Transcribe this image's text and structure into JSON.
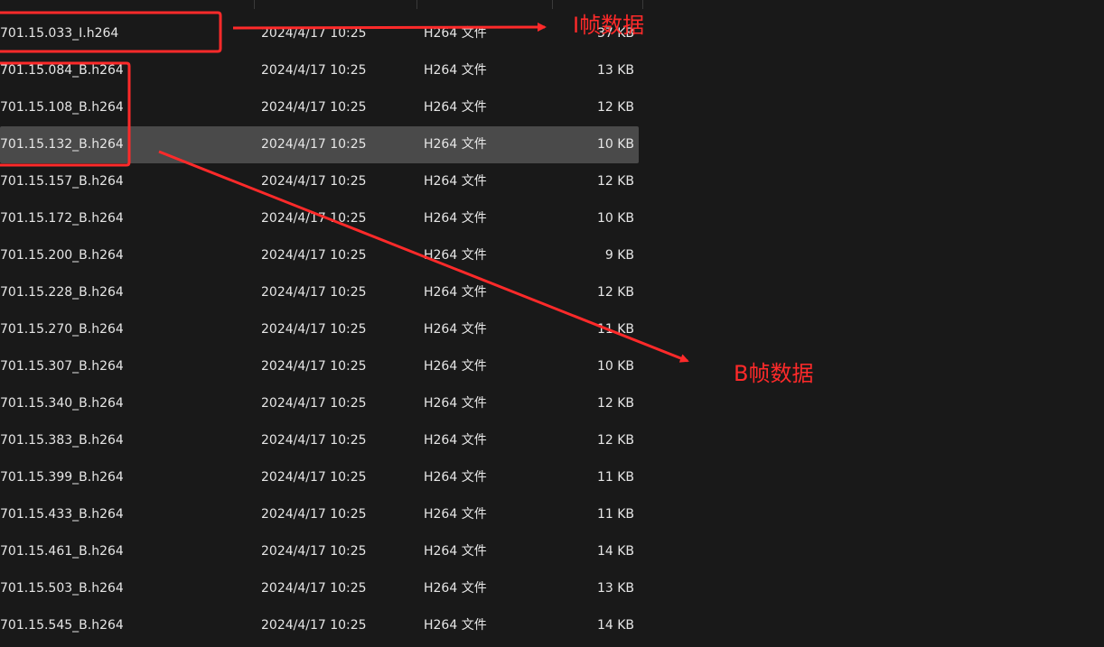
{
  "annotations": {
    "i_frame_label": "I帧数据",
    "b_frame_label": "B帧数据",
    "color": "#ff2a2a"
  },
  "files": [
    {
      "name": "701.15.033_I.h264",
      "date": "2024/4/17 10:25",
      "type": "H264 文件",
      "size": "37 KB"
    },
    {
      "name": "701.15.084_B.h264",
      "date": "2024/4/17 10:25",
      "type": "H264 文件",
      "size": "13 KB"
    },
    {
      "name": "701.15.108_B.h264",
      "date": "2024/4/17 10:25",
      "type": "H264 文件",
      "size": "12 KB"
    },
    {
      "name": "701.15.132_B.h264",
      "date": "2024/4/17 10:25",
      "type": "H264 文件",
      "size": "10 KB",
      "selected": true
    },
    {
      "name": "701.15.157_B.h264",
      "date": "2024/4/17 10:25",
      "type": "H264 文件",
      "size": "12 KB"
    },
    {
      "name": "701.15.172_B.h264",
      "date": "2024/4/17 10:25",
      "type": "H264 文件",
      "size": "10 KB"
    },
    {
      "name": "701.15.200_B.h264",
      "date": "2024/4/17 10:25",
      "type": "H264 文件",
      "size": "9 KB"
    },
    {
      "name": "701.15.228_B.h264",
      "date": "2024/4/17 10:25",
      "type": "H264 文件",
      "size": "12 KB"
    },
    {
      "name": "701.15.270_B.h264",
      "date": "2024/4/17 10:25",
      "type": "H264 文件",
      "size": "11 KB"
    },
    {
      "name": "701.15.307_B.h264",
      "date": "2024/4/17 10:25",
      "type": "H264 文件",
      "size": "10 KB"
    },
    {
      "name": "701.15.340_B.h264",
      "date": "2024/4/17 10:25",
      "type": "H264 文件",
      "size": "12 KB"
    },
    {
      "name": "701.15.383_B.h264",
      "date": "2024/4/17 10:25",
      "type": "H264 文件",
      "size": "12 KB"
    },
    {
      "name": "701.15.399_B.h264",
      "date": "2024/4/17 10:25",
      "type": "H264 文件",
      "size": "11 KB"
    },
    {
      "name": "701.15.433_B.h264",
      "date": "2024/4/17 10:25",
      "type": "H264 文件",
      "size": "11 KB"
    },
    {
      "name": "701.15.461_B.h264",
      "date": "2024/4/17 10:25",
      "type": "H264 文件",
      "size": "14 KB"
    },
    {
      "name": "701.15.503_B.h264",
      "date": "2024/4/17 10:25",
      "type": "H264 文件",
      "size": "13 KB"
    },
    {
      "name": "701.15.545_B.h264",
      "date": "2024/4/17 10:25",
      "type": "H264 文件",
      "size": "14 KB"
    }
  ]
}
